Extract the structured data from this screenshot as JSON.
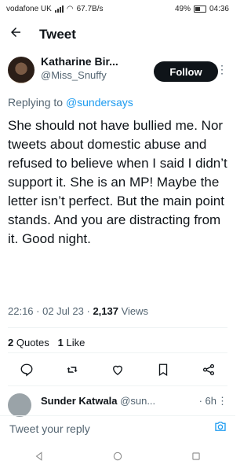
{
  "status_bar": {
    "carrier": "vodafone UK",
    "speed": "67.7B/s",
    "battery": "49%",
    "time": "04:36",
    "battery_level": 0.49
  },
  "header": {
    "title": "Tweet"
  },
  "author": {
    "display_name": "Katharine Bir...",
    "handle": "@Miss_Snuffy",
    "follow_label": "Follow"
  },
  "tweet": {
    "replying_prefix": "Replying to ",
    "replying_handle": "@sundersays",
    "text": "She should not have bullied me. Nor tweets about domestic abuse and refused to believe when I said I didn’t support it. She is an MP! Maybe the letter isn’t perfect. But the main point stands. And you are distracting from it. Good night.",
    "time": "22:16",
    "date": "02 Jul 23",
    "views_count": "2,137",
    "views_label": "Views"
  },
  "stats": {
    "quotes_count": "2",
    "quotes_label": "Quotes",
    "likes_count": "1",
    "likes_label": "Like"
  },
  "reply": {
    "name": "Sunder Katwala",
    "handle": "@sun...",
    "time": "· 6h"
  },
  "compose": {
    "placeholder": "Tweet your reply"
  },
  "colors": {
    "accent": "#1d9bf0",
    "text": "#0f1419",
    "muted": "#536471"
  },
  "icons": [
    "back-arrow-icon",
    "more-icon",
    "reply-icon",
    "retweet-icon",
    "like-icon",
    "bookmark-icon",
    "share-icon",
    "camera-icon",
    "nav-back-icon",
    "nav-home-icon",
    "nav-recents-icon"
  ]
}
